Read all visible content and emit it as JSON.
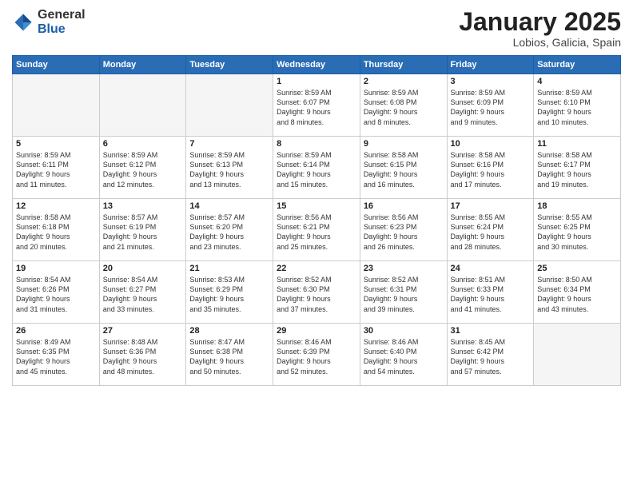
{
  "header": {
    "logo_general": "General",
    "logo_blue": "Blue",
    "title": "January 2025",
    "subtitle": "Lobios, Galicia, Spain"
  },
  "weekdays": [
    "Sunday",
    "Monday",
    "Tuesday",
    "Wednesday",
    "Thursday",
    "Friday",
    "Saturday"
  ],
  "weeks": [
    [
      {
        "day": "",
        "info": ""
      },
      {
        "day": "",
        "info": ""
      },
      {
        "day": "",
        "info": ""
      },
      {
        "day": "1",
        "info": "Sunrise: 8:59 AM\nSunset: 6:07 PM\nDaylight: 9 hours\nand 8 minutes."
      },
      {
        "day": "2",
        "info": "Sunrise: 8:59 AM\nSunset: 6:08 PM\nDaylight: 9 hours\nand 8 minutes."
      },
      {
        "day": "3",
        "info": "Sunrise: 8:59 AM\nSunset: 6:09 PM\nDaylight: 9 hours\nand 9 minutes."
      },
      {
        "day": "4",
        "info": "Sunrise: 8:59 AM\nSunset: 6:10 PM\nDaylight: 9 hours\nand 10 minutes."
      }
    ],
    [
      {
        "day": "5",
        "info": "Sunrise: 8:59 AM\nSunset: 6:11 PM\nDaylight: 9 hours\nand 11 minutes."
      },
      {
        "day": "6",
        "info": "Sunrise: 8:59 AM\nSunset: 6:12 PM\nDaylight: 9 hours\nand 12 minutes."
      },
      {
        "day": "7",
        "info": "Sunrise: 8:59 AM\nSunset: 6:13 PM\nDaylight: 9 hours\nand 13 minutes."
      },
      {
        "day": "8",
        "info": "Sunrise: 8:59 AM\nSunset: 6:14 PM\nDaylight: 9 hours\nand 15 minutes."
      },
      {
        "day": "9",
        "info": "Sunrise: 8:58 AM\nSunset: 6:15 PM\nDaylight: 9 hours\nand 16 minutes."
      },
      {
        "day": "10",
        "info": "Sunrise: 8:58 AM\nSunset: 6:16 PM\nDaylight: 9 hours\nand 17 minutes."
      },
      {
        "day": "11",
        "info": "Sunrise: 8:58 AM\nSunset: 6:17 PM\nDaylight: 9 hours\nand 19 minutes."
      }
    ],
    [
      {
        "day": "12",
        "info": "Sunrise: 8:58 AM\nSunset: 6:18 PM\nDaylight: 9 hours\nand 20 minutes."
      },
      {
        "day": "13",
        "info": "Sunrise: 8:57 AM\nSunset: 6:19 PM\nDaylight: 9 hours\nand 21 minutes."
      },
      {
        "day": "14",
        "info": "Sunrise: 8:57 AM\nSunset: 6:20 PM\nDaylight: 9 hours\nand 23 minutes."
      },
      {
        "day": "15",
        "info": "Sunrise: 8:56 AM\nSunset: 6:21 PM\nDaylight: 9 hours\nand 25 minutes."
      },
      {
        "day": "16",
        "info": "Sunrise: 8:56 AM\nSunset: 6:23 PM\nDaylight: 9 hours\nand 26 minutes."
      },
      {
        "day": "17",
        "info": "Sunrise: 8:55 AM\nSunset: 6:24 PM\nDaylight: 9 hours\nand 28 minutes."
      },
      {
        "day": "18",
        "info": "Sunrise: 8:55 AM\nSunset: 6:25 PM\nDaylight: 9 hours\nand 30 minutes."
      }
    ],
    [
      {
        "day": "19",
        "info": "Sunrise: 8:54 AM\nSunset: 6:26 PM\nDaylight: 9 hours\nand 31 minutes."
      },
      {
        "day": "20",
        "info": "Sunrise: 8:54 AM\nSunset: 6:27 PM\nDaylight: 9 hours\nand 33 minutes."
      },
      {
        "day": "21",
        "info": "Sunrise: 8:53 AM\nSunset: 6:29 PM\nDaylight: 9 hours\nand 35 minutes."
      },
      {
        "day": "22",
        "info": "Sunrise: 8:52 AM\nSunset: 6:30 PM\nDaylight: 9 hours\nand 37 minutes."
      },
      {
        "day": "23",
        "info": "Sunrise: 8:52 AM\nSunset: 6:31 PM\nDaylight: 9 hours\nand 39 minutes."
      },
      {
        "day": "24",
        "info": "Sunrise: 8:51 AM\nSunset: 6:33 PM\nDaylight: 9 hours\nand 41 minutes."
      },
      {
        "day": "25",
        "info": "Sunrise: 8:50 AM\nSunset: 6:34 PM\nDaylight: 9 hours\nand 43 minutes."
      }
    ],
    [
      {
        "day": "26",
        "info": "Sunrise: 8:49 AM\nSunset: 6:35 PM\nDaylight: 9 hours\nand 45 minutes."
      },
      {
        "day": "27",
        "info": "Sunrise: 8:48 AM\nSunset: 6:36 PM\nDaylight: 9 hours\nand 48 minutes."
      },
      {
        "day": "28",
        "info": "Sunrise: 8:47 AM\nSunset: 6:38 PM\nDaylight: 9 hours\nand 50 minutes."
      },
      {
        "day": "29",
        "info": "Sunrise: 8:46 AM\nSunset: 6:39 PM\nDaylight: 9 hours\nand 52 minutes."
      },
      {
        "day": "30",
        "info": "Sunrise: 8:46 AM\nSunset: 6:40 PM\nDaylight: 9 hours\nand 54 minutes."
      },
      {
        "day": "31",
        "info": "Sunrise: 8:45 AM\nSunset: 6:42 PM\nDaylight: 9 hours\nand 57 minutes."
      },
      {
        "day": "",
        "info": ""
      }
    ]
  ]
}
